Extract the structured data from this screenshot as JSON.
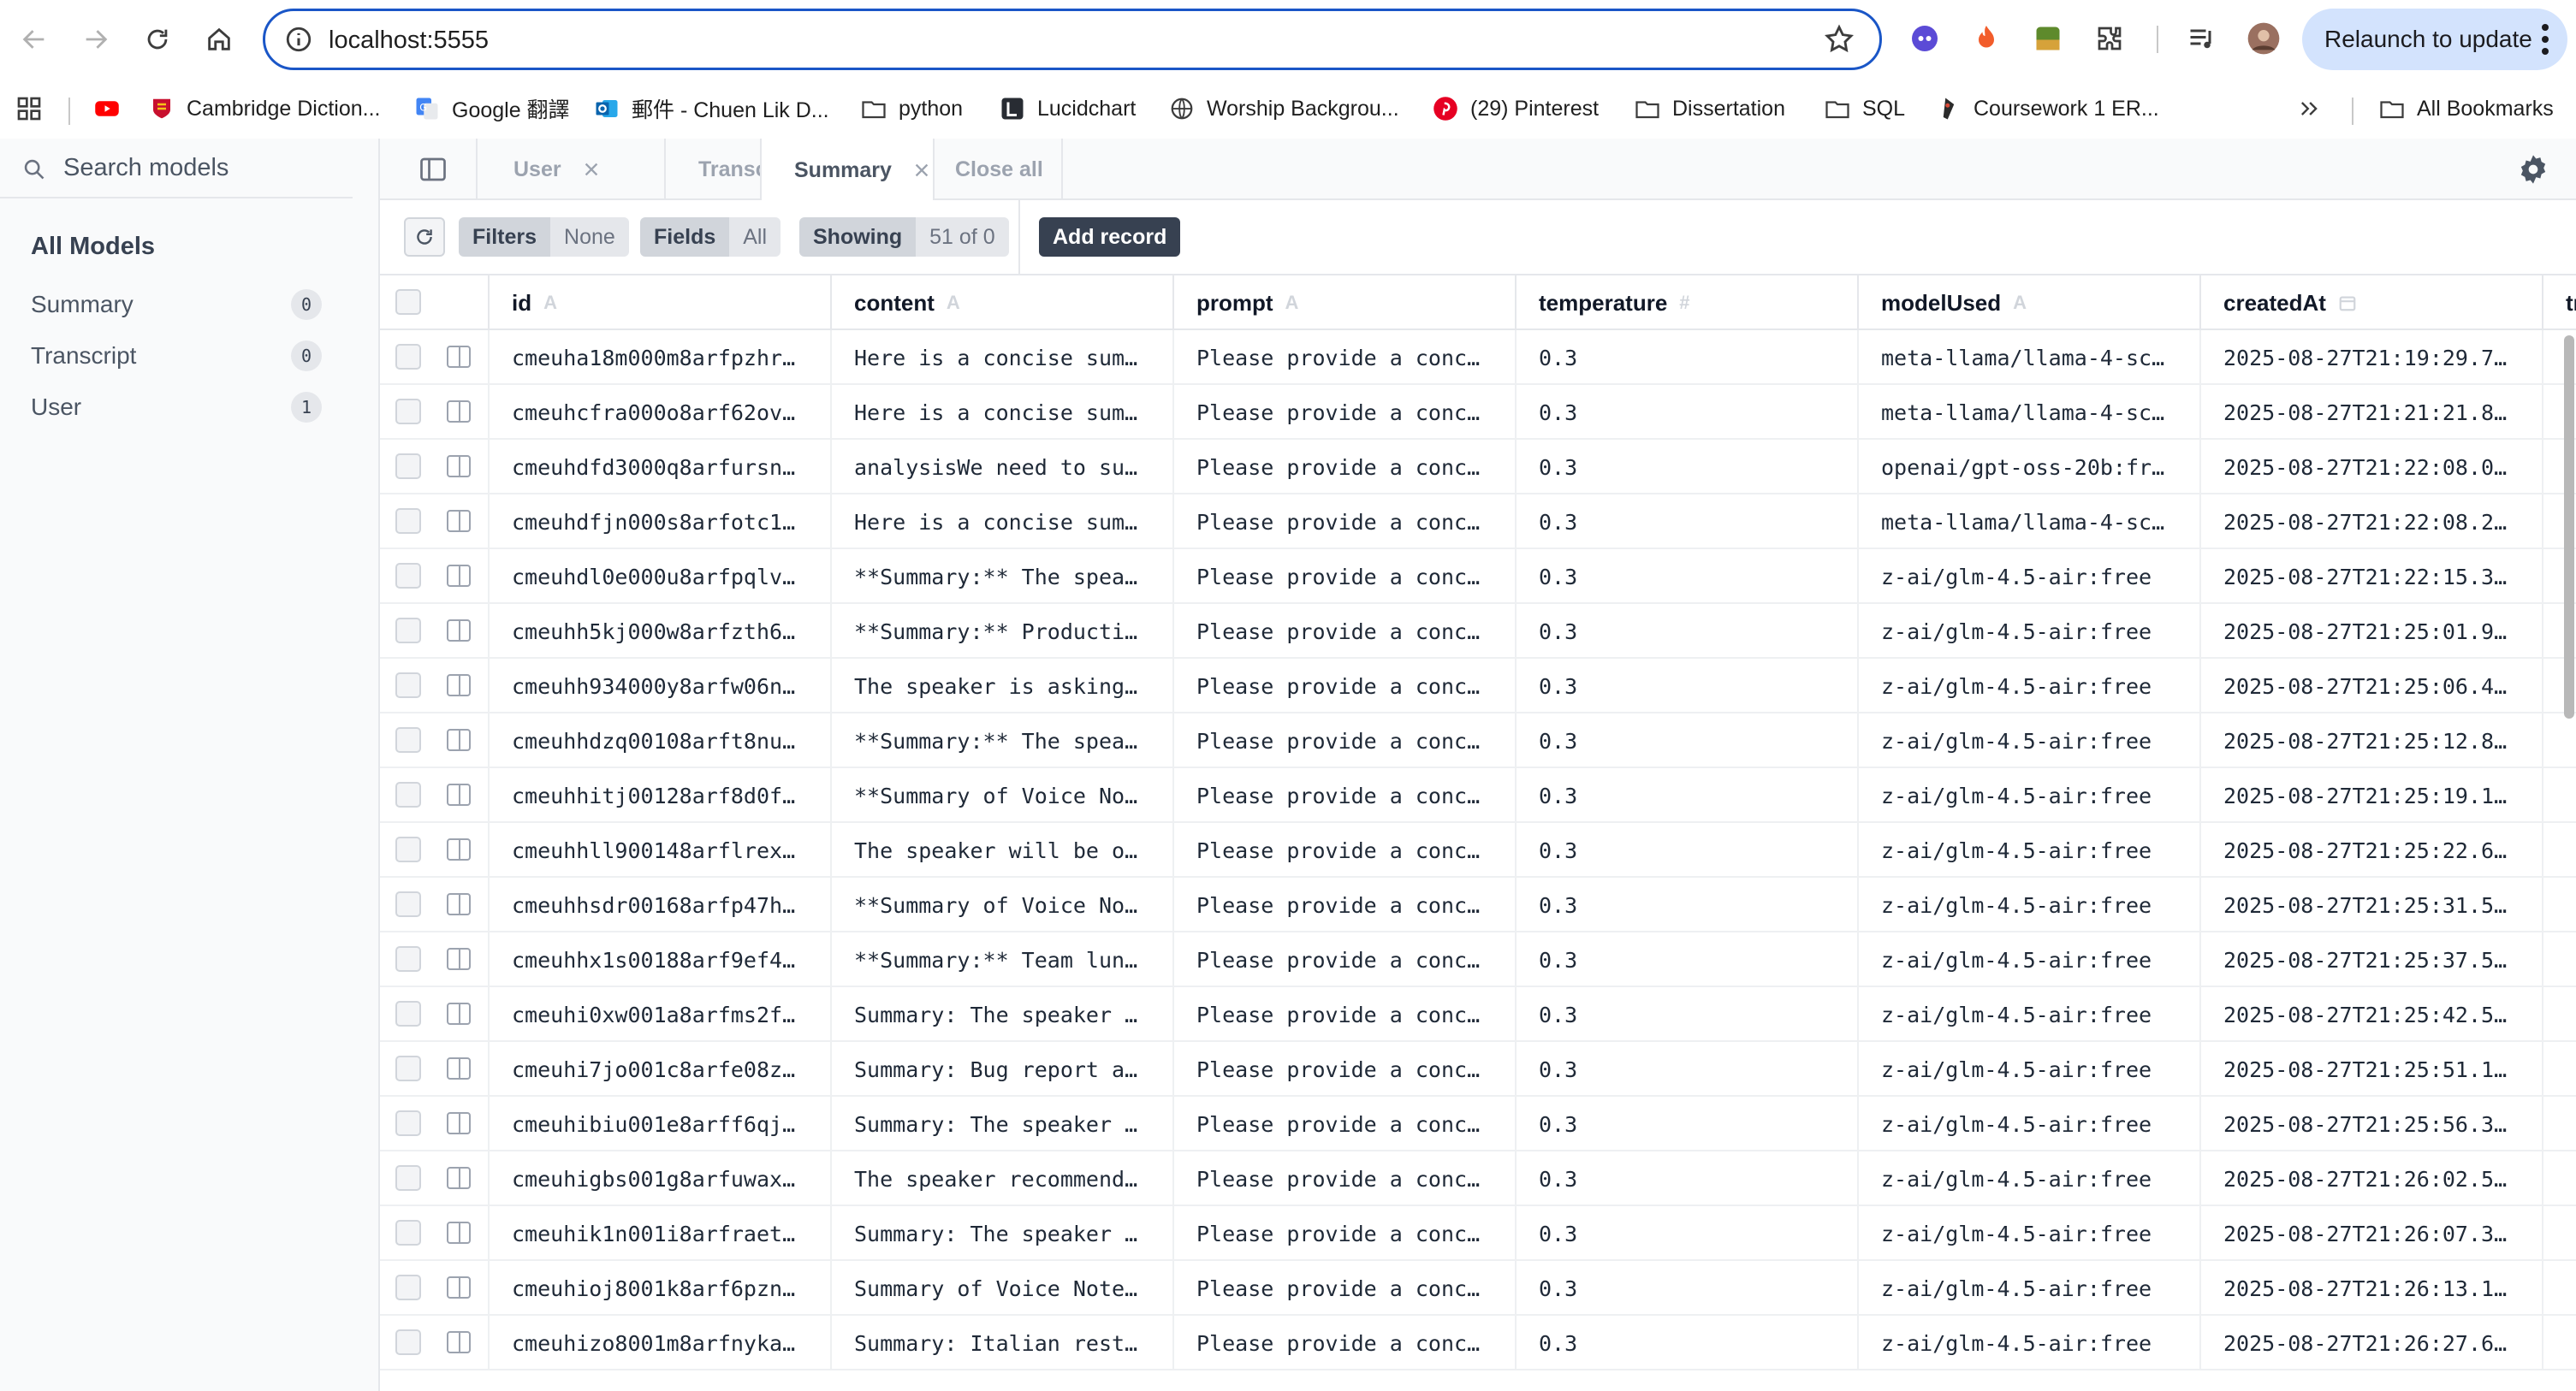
{
  "browser": {
    "url": "localhost:5555",
    "relaunch_label": "Relaunch to update",
    "bookmarks": [
      {
        "label": "",
        "icon": "youtube-icon",
        "color": "#ff0000"
      },
      {
        "label": "Cambridge Diction...",
        "icon": "cambridge-icon"
      },
      {
        "label": "Google 翻譯",
        "icon": "google-translate-icon"
      },
      {
        "label": "郵件 - Chuen Lik D...",
        "icon": "outlook-icon"
      },
      {
        "label": "python",
        "icon": "folder-icon"
      },
      {
        "label": "Lucidchart",
        "icon": "lucidchart-icon"
      },
      {
        "label": "Worship Backgrou...",
        "icon": "globe-icon"
      },
      {
        "label": "(29) Pinterest",
        "icon": "pinterest-icon"
      },
      {
        "label": "Dissertation",
        "icon": "folder-icon"
      },
      {
        "label": "SQL",
        "icon": "folder-icon"
      },
      {
        "label": "Coursework 1 ER...",
        "icon": "coursework-icon"
      }
    ],
    "all_bookmarks_label": "All Bookmarks"
  },
  "sidebar": {
    "search_placeholder": "Search models",
    "heading": "All Models",
    "items": [
      {
        "label": "Summary",
        "count": "0"
      },
      {
        "label": "Transcript",
        "count": "0"
      },
      {
        "label": "User",
        "count": "1"
      }
    ]
  },
  "tabs": [
    {
      "label": "User",
      "active": false
    },
    {
      "label": "Transcript",
      "active": false
    },
    {
      "label": "Summary",
      "active": true
    }
  ],
  "close_all_label": "Close all",
  "toolbar": {
    "filters_label": "Filters",
    "filters_value": "None",
    "fields_label": "Fields",
    "fields_value": "All",
    "showing_label": "Showing",
    "showing_value": "51 of 0",
    "add_record_label": "Add record"
  },
  "table": {
    "columns": [
      {
        "name": "id",
        "type": "A"
      },
      {
        "name": "content",
        "type": "A"
      },
      {
        "name": "prompt",
        "type": "A"
      },
      {
        "name": "temperature",
        "type": "#"
      },
      {
        "name": "modelUsed",
        "type": "A"
      },
      {
        "name": "createdAt",
        "type": "calendar"
      },
      {
        "name": "tr",
        "type": ""
      }
    ],
    "rows": [
      [
        "cmeuha18m000m8arfpzhr…",
        "Here is a concise sum…",
        "Please provide a conc…",
        "0.3",
        "meta-llama/llama-4-sc…",
        "2025-08-27T21:19:29.7…"
      ],
      [
        "cmeuhcfra000o8arf62ov…",
        "Here is a concise sum…",
        "Please provide a conc…",
        "0.3",
        "meta-llama/llama-4-sc…",
        "2025-08-27T21:21:21.8…"
      ],
      [
        "cmeuhdfd3000q8arfursn…",
        "analysisWe need to su…",
        "Please provide a conc…",
        "0.3",
        "openai/gpt-oss-20b:fr…",
        "2025-08-27T21:22:08.0…"
      ],
      [
        "cmeuhdfjn000s8arfotc1…",
        "Here is a concise sum…",
        "Please provide a conc…",
        "0.3",
        "meta-llama/llama-4-sc…",
        "2025-08-27T21:22:08.2…"
      ],
      [
        "cmeuhdl0e000u8arfpqlv…",
        "**Summary:** The spea…",
        "Please provide a conc…",
        "0.3",
        "z-ai/glm-4.5-air:free",
        "2025-08-27T21:22:15.3…"
      ],
      [
        "cmeuhh5kj000w8arfzth6…",
        "**Summary:** Producti…",
        "Please provide a conc…",
        "0.3",
        "z-ai/glm-4.5-air:free",
        "2025-08-27T21:25:01.9…"
      ],
      [
        "cmeuhh934000y8arfw06n…",
        "The speaker is asking…",
        "Please provide a conc…",
        "0.3",
        "z-ai/glm-4.5-air:free",
        "2025-08-27T21:25:06.4…"
      ],
      [
        "cmeuhhdzq00108arft8nu…",
        "**Summary:** The spea…",
        "Please provide a conc…",
        "0.3",
        "z-ai/glm-4.5-air:free",
        "2025-08-27T21:25:12.8…"
      ],
      [
        "cmeuhhitj00128arf8d0f…",
        "**Summary of Voice No…",
        "Please provide a conc…",
        "0.3",
        "z-ai/glm-4.5-air:free",
        "2025-08-27T21:25:19.1…"
      ],
      [
        "cmeuhhll900148arflrex…",
        "The speaker will be o…",
        "Please provide a conc…",
        "0.3",
        "z-ai/glm-4.5-air:free",
        "2025-08-27T21:25:22.6…"
      ],
      [
        "cmeuhhsdr00168arfp47h…",
        "**Summary of Voice No…",
        "Please provide a conc…",
        "0.3",
        "z-ai/glm-4.5-air:free",
        "2025-08-27T21:25:31.5…"
      ],
      [
        "cmeuhhx1s00188arf9ef4…",
        "**Summary:** Team lun…",
        "Please provide a conc…",
        "0.3",
        "z-ai/glm-4.5-air:free",
        "2025-08-27T21:25:37.5…"
      ],
      [
        "cmeuhi0xw001a8arfms2f…",
        "Summary: The speaker …",
        "Please provide a conc…",
        "0.3",
        "z-ai/glm-4.5-air:free",
        "2025-08-27T21:25:42.5…"
      ],
      [
        "cmeuhi7jo001c8arfe08z…",
        "Summary: Bug report a…",
        "Please provide a conc…",
        "0.3",
        "z-ai/glm-4.5-air:free",
        "2025-08-27T21:25:51.1…"
      ],
      [
        "cmeuhibiu001e8arff6qj…",
        "Summary: The speaker …",
        "Please provide a conc…",
        "0.3",
        "z-ai/glm-4.5-air:free",
        "2025-08-27T21:25:56.3…"
      ],
      [
        "cmeuhigbs001g8arfuwax…",
        "The speaker recommend…",
        "Please provide a conc…",
        "0.3",
        "z-ai/glm-4.5-air:free",
        "2025-08-27T21:26:02.5…"
      ],
      [
        "cmeuhik1n001i8arfraet…",
        "Summary: The speaker …",
        "Please provide a conc…",
        "0.3",
        "z-ai/glm-4.5-air:free",
        "2025-08-27T21:26:07.3…"
      ],
      [
        "cmeuhioj8001k8arf6pzn…",
        "Summary of Voice Note…",
        "Please provide a conc…",
        "0.3",
        "z-ai/glm-4.5-air:free",
        "2025-08-27T21:26:13.1…"
      ],
      [
        "cmeuhizo8001m8arfnyka…",
        "Summary: Italian rest…",
        "Please provide a conc…",
        "0.3",
        "z-ai/glm-4.5-air:free",
        "2025-08-27T21:26:27.6…"
      ]
    ]
  },
  "colors": {
    "omnibox_border": "#1a56c7",
    "relaunch_bg": "#d3e3fd",
    "add_record_bg": "#374151"
  }
}
